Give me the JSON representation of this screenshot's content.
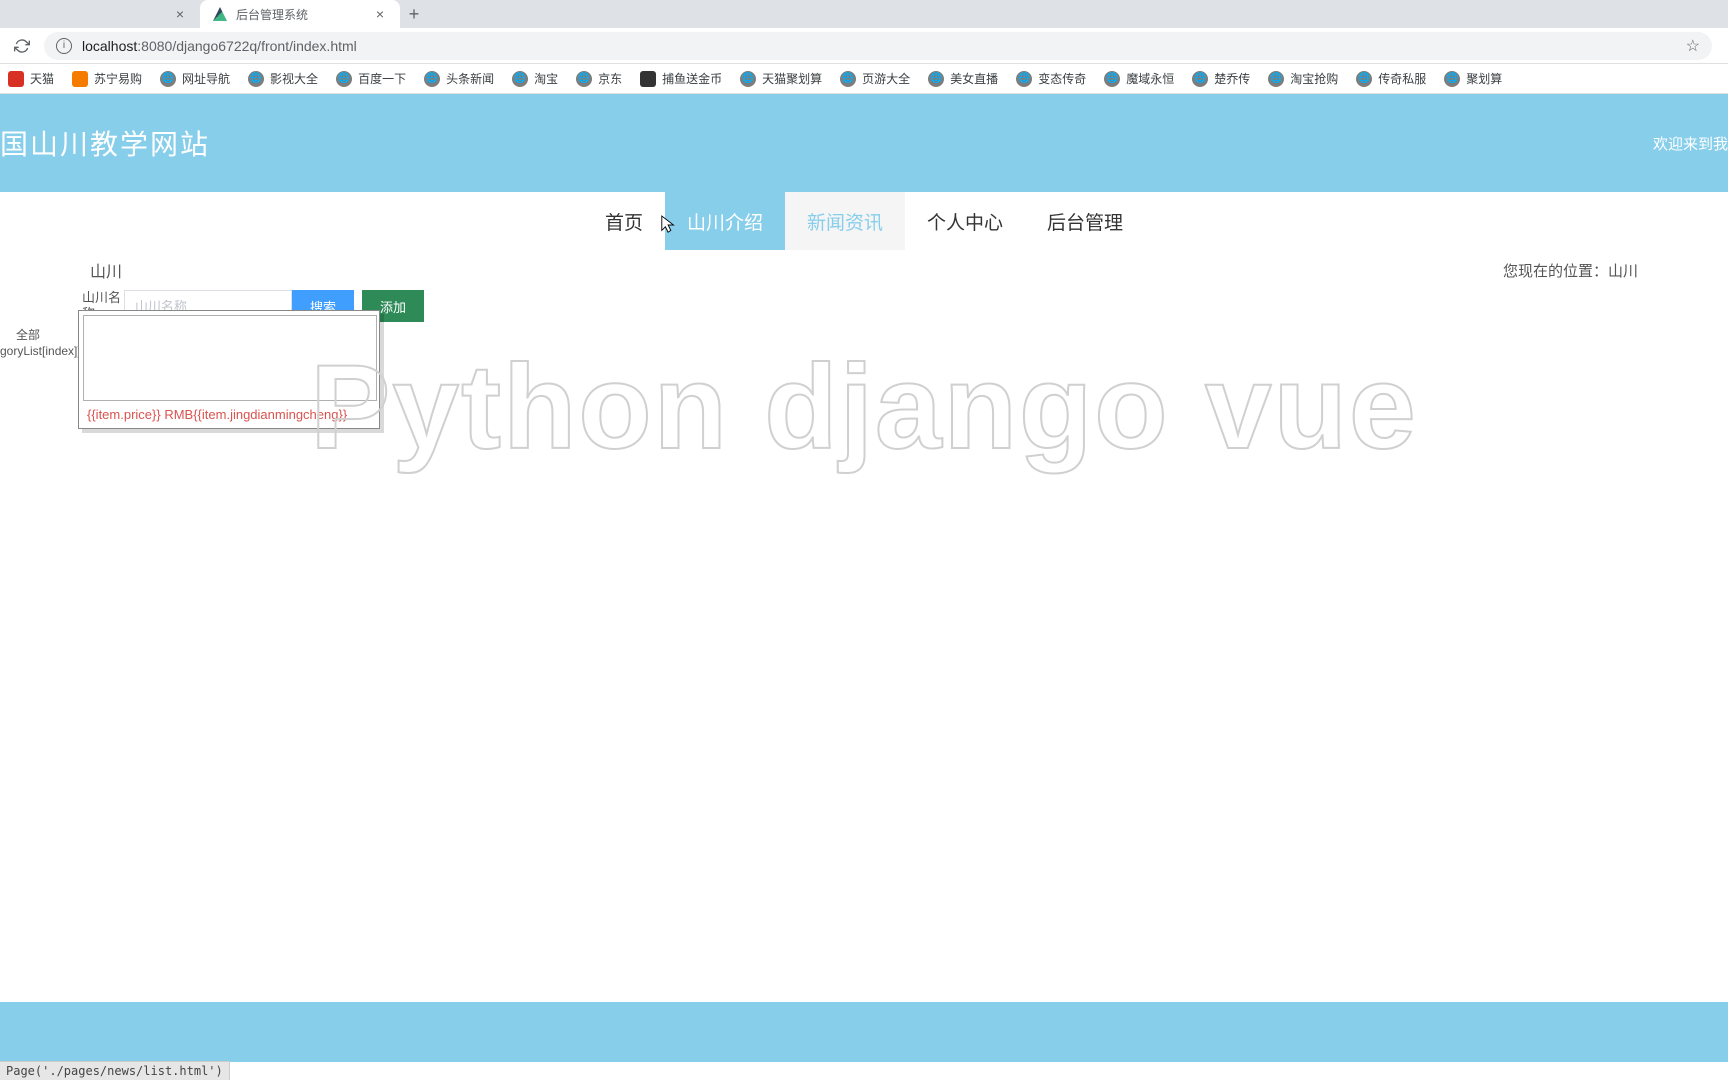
{
  "browser": {
    "tabs": [
      {
        "title": "",
        "active": false
      },
      {
        "title": "后台管理系统",
        "active": true
      }
    ],
    "url_host": "localhost",
    "url_port": ":8080",
    "url_path": "/django6722q/front/index.html"
  },
  "bookmarks": [
    "天猫",
    "苏宁易购",
    "网址导航",
    "影视大全",
    "百度一下",
    "头条新闻",
    "淘宝",
    "京东",
    "捕鱼送金币",
    "天猫聚划算",
    "页游大全",
    "美女直播",
    "变态传奇",
    "魔域永恒",
    "楚乔传",
    "淘宝抢购",
    "传奇私服",
    "聚划算"
  ],
  "header": {
    "site_title": "国山川教学网站",
    "welcome": "欢迎来到我"
  },
  "nav": [
    {
      "label": "首页",
      "state": "normal"
    },
    {
      "label": "山川介绍",
      "state": "active"
    },
    {
      "label": "新闻资讯",
      "state": "hover"
    },
    {
      "label": "个人中心",
      "state": "normal"
    },
    {
      "label": "后台管理",
      "state": "normal"
    }
  ],
  "breadcrumb": {
    "left": "山川",
    "right": "您现在的位置：山川"
  },
  "search": {
    "label": "山川名称",
    "placeholder": "山川名称",
    "search_btn": "搜索",
    "add_btn": "添加"
  },
  "category": {
    "all": "全部",
    "template": "goryList[index]}}"
  },
  "item": {
    "price_template": "{{item.price}} RMB{{item.jingdianmingcheng}}"
  },
  "watermark": "Python django vue",
  "status_bar": "Page('./pages/news/list.html')"
}
